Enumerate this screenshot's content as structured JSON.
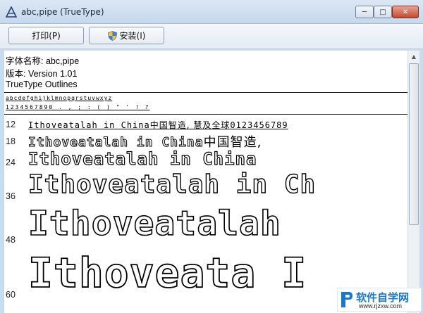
{
  "window": {
    "title": "abc,pipe (TrueType)",
    "controls": {
      "minimize": "─",
      "maximize": "□",
      "close": "✕"
    }
  },
  "toolbar": {
    "print_label": "打印(P)",
    "install_label": "安装(I)"
  },
  "font_info": {
    "name_line": "字体名称: abc,pipe",
    "version_line": "版本: Version 1.01",
    "type_line": "TrueType Outlines"
  },
  "charset": {
    "line1": "abcdefghijklmnopqrstuvwxyz",
    "line2": "1234567890 . , ; : ( ) \" ' ! ?"
  },
  "samples": [
    {
      "size": "12",
      "latin": "Ithoveatalah in China",
      "cjk": "中国智造, 慧及全球",
      "tail": "0123456789"
    },
    {
      "size": "18",
      "latin": "Ithoveatalah in China",
      "cjk": "中国智造,"
    },
    {
      "size": "24",
      "latin": "Ithoveatalah in China"
    },
    {
      "size": "36",
      "latin": "Ithoveatalah in Ch"
    },
    {
      "size": "48",
      "latin": "Ithoveatalah"
    },
    {
      "size": "60",
      "latin": "Ithoveata I"
    }
  ],
  "watermark": {
    "title": "软件自学网",
    "url": "www.rjzxw.com"
  }
}
